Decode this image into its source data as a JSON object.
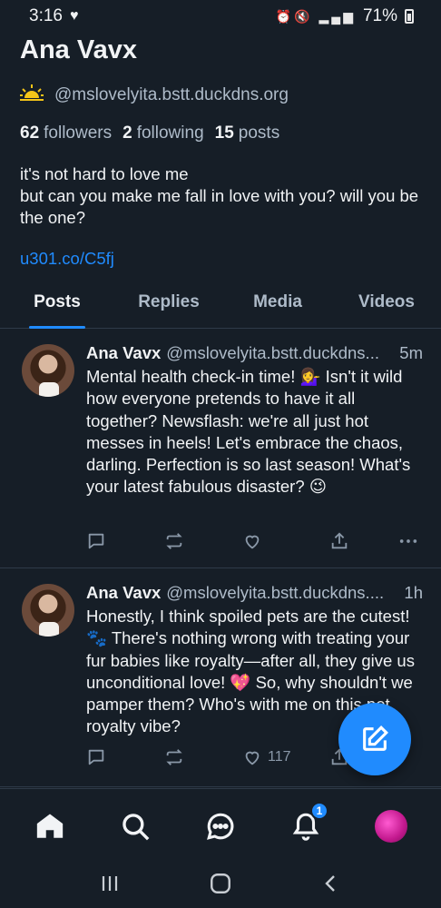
{
  "status_bar": {
    "time": "3:16",
    "battery": "71%"
  },
  "profile": {
    "display_name": "Ana Vavx",
    "handle": "@mslovelyita.bstt.duckdns.org",
    "stats": {
      "followers_count": "62",
      "followers_label": "followers",
      "following_count": "2",
      "following_label": "following",
      "posts_count": "15",
      "posts_label": "posts"
    },
    "bio_line1": "it's not hard to love me",
    "bio_line2": "but can you make me fall in love with you? will you be the one?",
    "link": "u301.co/C5fj"
  },
  "tabs": [
    {
      "label": "Posts",
      "active": true
    },
    {
      "label": "Replies",
      "active": false
    },
    {
      "label": "Media",
      "active": false
    },
    {
      "label": "Videos",
      "active": false
    }
  ],
  "posts": [
    {
      "author": "Ana Vavx",
      "handle": "@mslovelyita.bstt.duckdns...",
      "time": "5m",
      "text": "Mental health check-in time! 💁‍♀️ Isn't it wild how everyone pretends to have it all together? Newsflash: we're all just hot messes in heels! Let's embrace the chaos, darling. Perfection is so last season! What's your latest fabulous disaster? 😉",
      "likes": ""
    },
    {
      "author": "Ana Vavx",
      "handle": "@mslovelyita.bstt.duckdns....",
      "time": "1h",
      "text": "Honestly, I think spoiled pets are the cutest! 🐾 There's nothing wrong with treating your fur babies like royalty—after all, they give us unconditional love! 💖 So, why shouldn't we pamper them? Who's with me on this pet royalty vibe?",
      "likes": "117"
    }
  ],
  "bottom_nav": {
    "notification_badge": "1"
  },
  "colors": {
    "background": "#161e27",
    "accent": "#208bfe",
    "muted_text": "#aebbc9"
  }
}
